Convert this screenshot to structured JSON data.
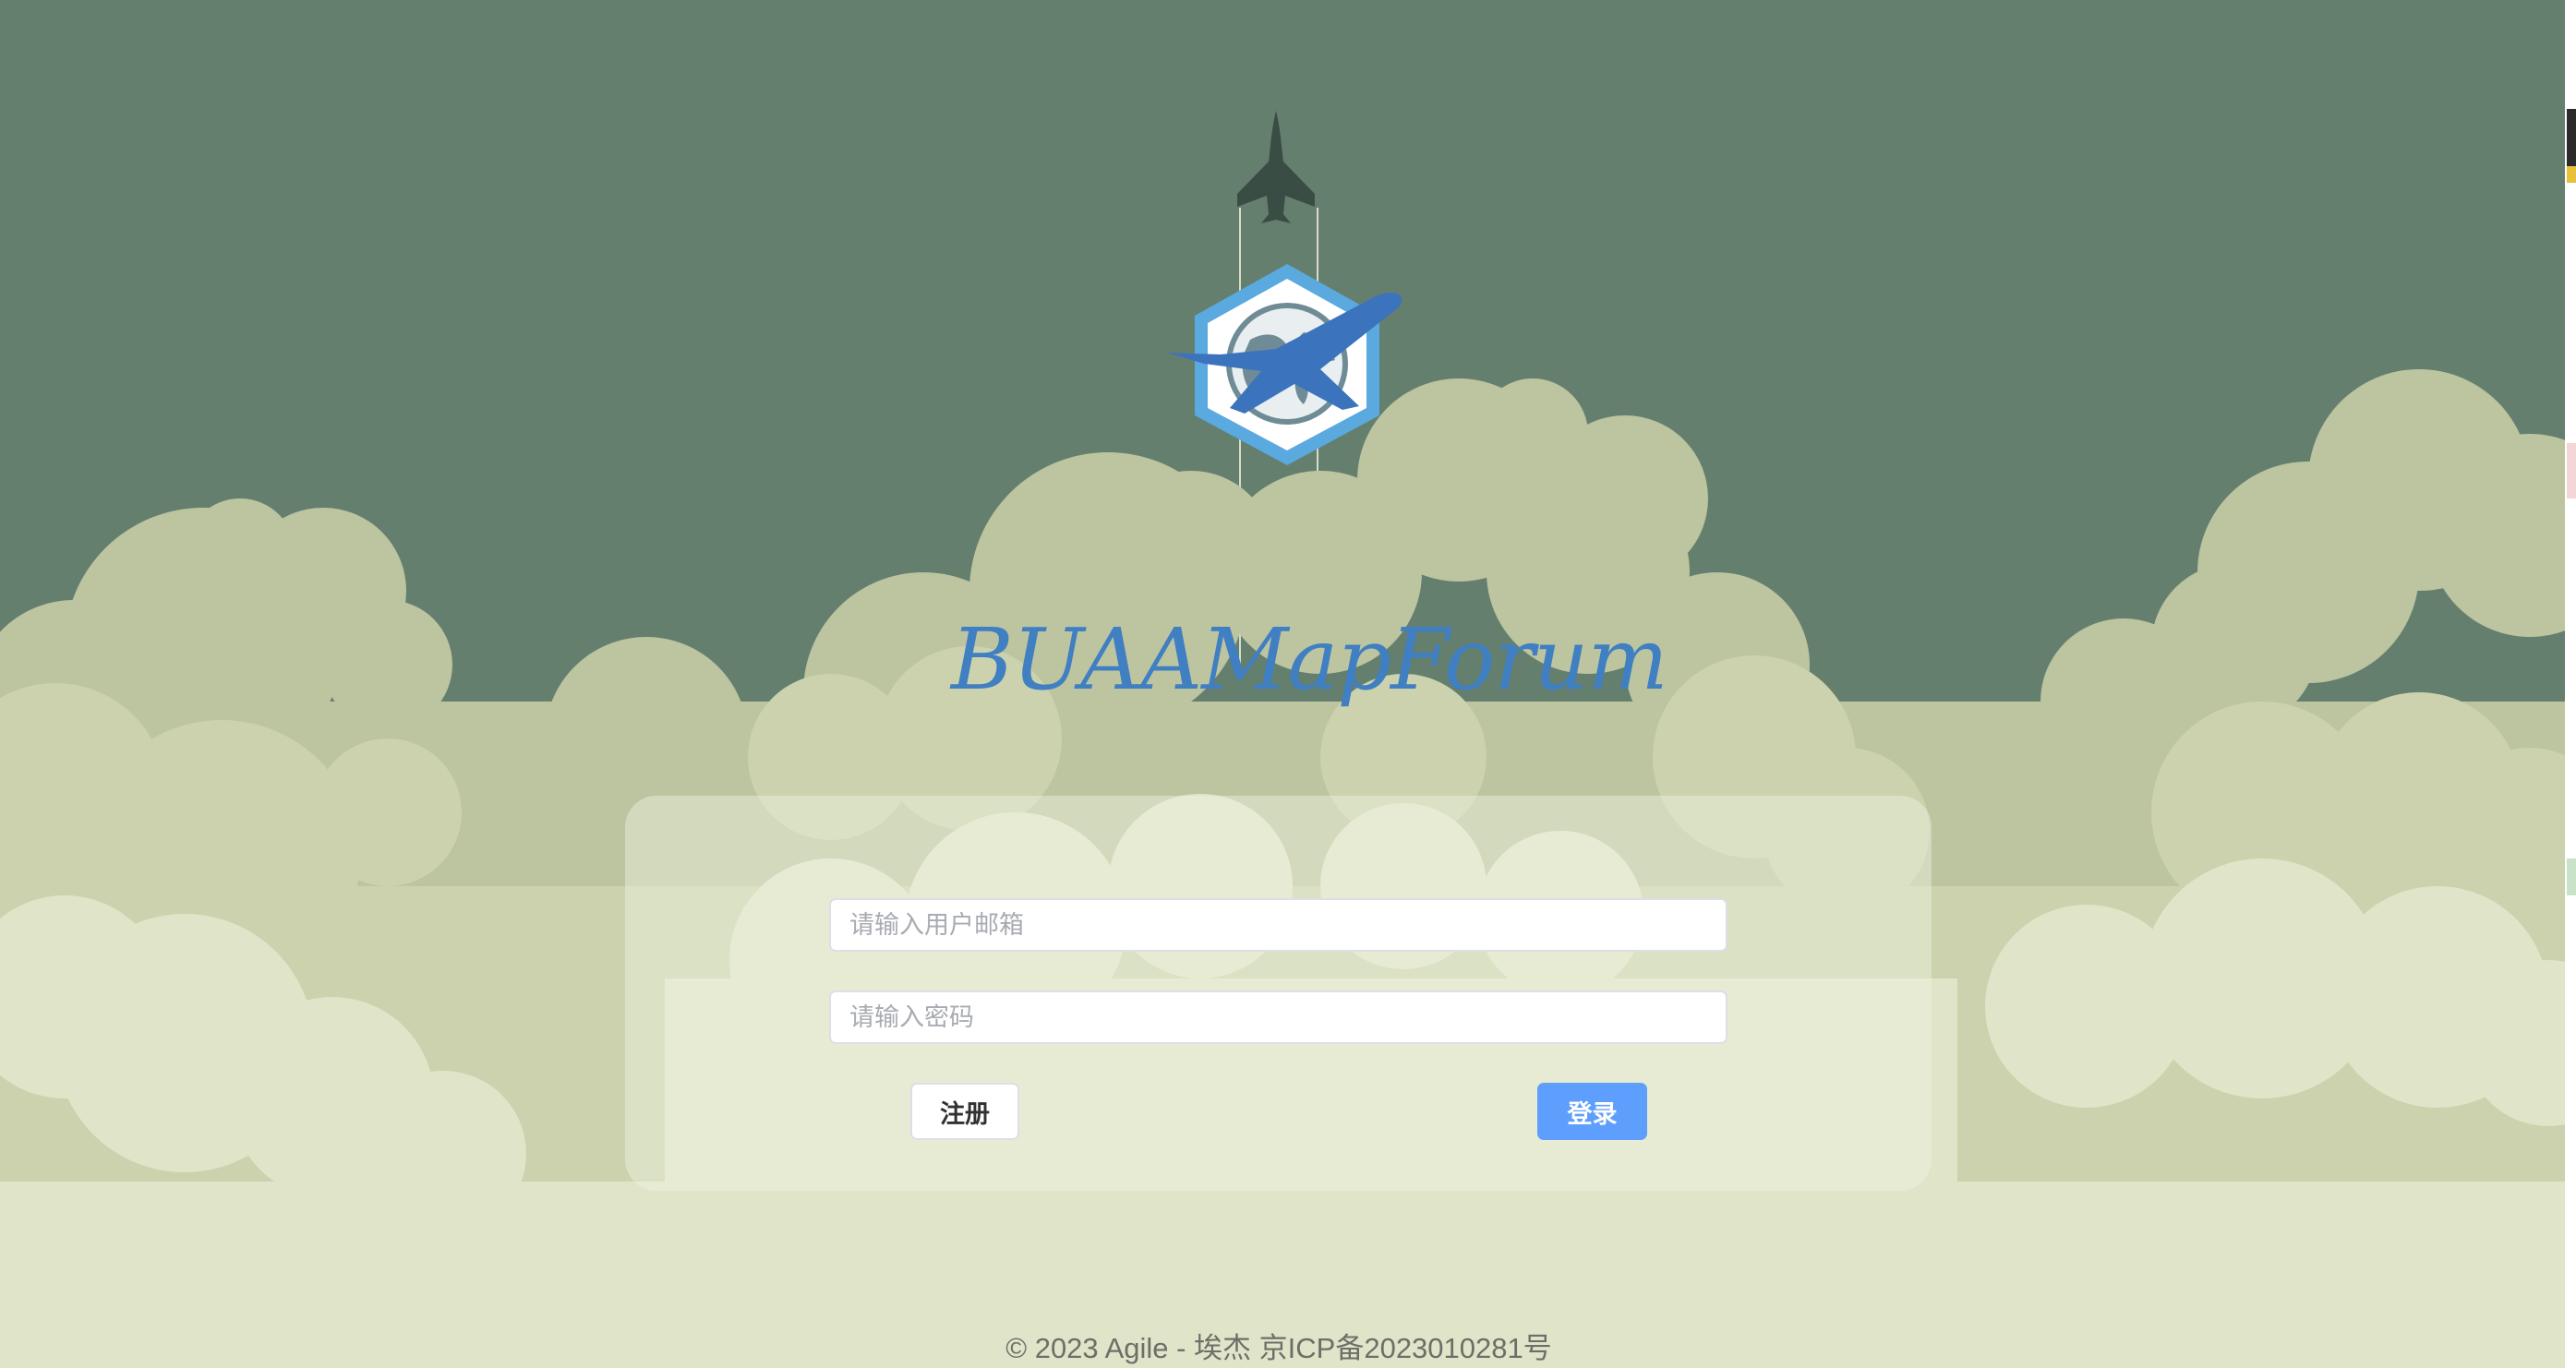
{
  "site": {
    "title": "BUAAMapForum"
  },
  "login_form": {
    "email_placeholder": "请输入用户邮箱",
    "password_placeholder": "请输入密码",
    "register_label": "注册",
    "login_label": "登录"
  },
  "footer": {
    "text": "© 2023 Agile - 埃杰 京ICP备2023010281号"
  },
  "icons": {
    "rocket": "jet-rocket-icon",
    "logo": "globe-airplane-logo-icon"
  },
  "colors": {
    "sky": "#657f6f",
    "cloud_light": "#e0e4c8",
    "cloud_mid": "#cbd2ad",
    "cloud_dark": "#bcc4a0",
    "title": "#3f7fc2",
    "primary_button": "#5e9efc",
    "logo_hex": "#5aa9df",
    "rocket": "#3a4d44"
  }
}
